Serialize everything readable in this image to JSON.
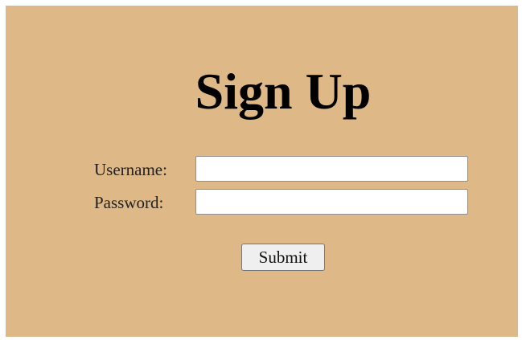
{
  "page": {
    "background_color": "#deb887"
  },
  "form": {
    "title": "Sign Up",
    "username_label": "Username:",
    "username_value": "",
    "username_placeholder": "",
    "password_label": "Password:",
    "password_value": "",
    "password_placeholder": "",
    "submit_label": "Submit"
  }
}
